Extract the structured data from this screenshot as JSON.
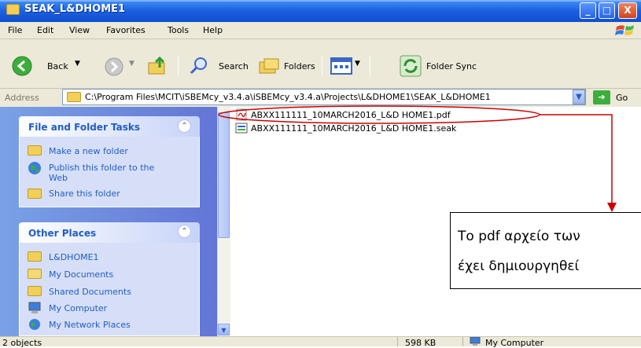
{
  "window": {
    "title": "SEAK_L&DHOME1",
    "buttons": {
      "minimize": "_",
      "maximize": "□",
      "close": "X"
    }
  },
  "menu": [
    "File",
    "Edit",
    "View",
    "Favorites",
    "Tools",
    "Help"
  ],
  "toolbar": {
    "back": "Back",
    "search": "Search",
    "folders": "Folders",
    "folder_sync": "Folder Sync"
  },
  "address": {
    "label": "Address",
    "path": "C:\\Program Files\\MCIT\\iSBEMcy_v3.4.a\\iSBEMcy_v3.4.a\\Projects\\L&DHOME1\\SEAK_L&DHOME1",
    "go": "Go"
  },
  "task_pane": {
    "file_tasks": {
      "title": "File and Folder Tasks",
      "items": [
        "Make a new folder",
        "Publish this folder to the Web",
        "Share this folder"
      ]
    },
    "other_places": {
      "title": "Other Places",
      "items": [
        "L&DHOME1",
        "My Documents",
        "Shared Documents",
        "My Computer",
        "My Network Places"
      ]
    }
  },
  "files": [
    {
      "name": "ABXX111111_10MARCH2016_L&D HOME1.pdf",
      "type": "pdf"
    },
    {
      "name": "ABXX111111_10MARCH2016_L&D HOME1.seak",
      "type": "seak"
    }
  ],
  "annotation": {
    "line1": "Το pdf αρχείο των ",
    "line2": "έχει δημιουργηθεί",
    "color": "#cc0000"
  },
  "status": {
    "objects": "2 objects",
    "size": "598 KB",
    "location": "My Computer"
  }
}
